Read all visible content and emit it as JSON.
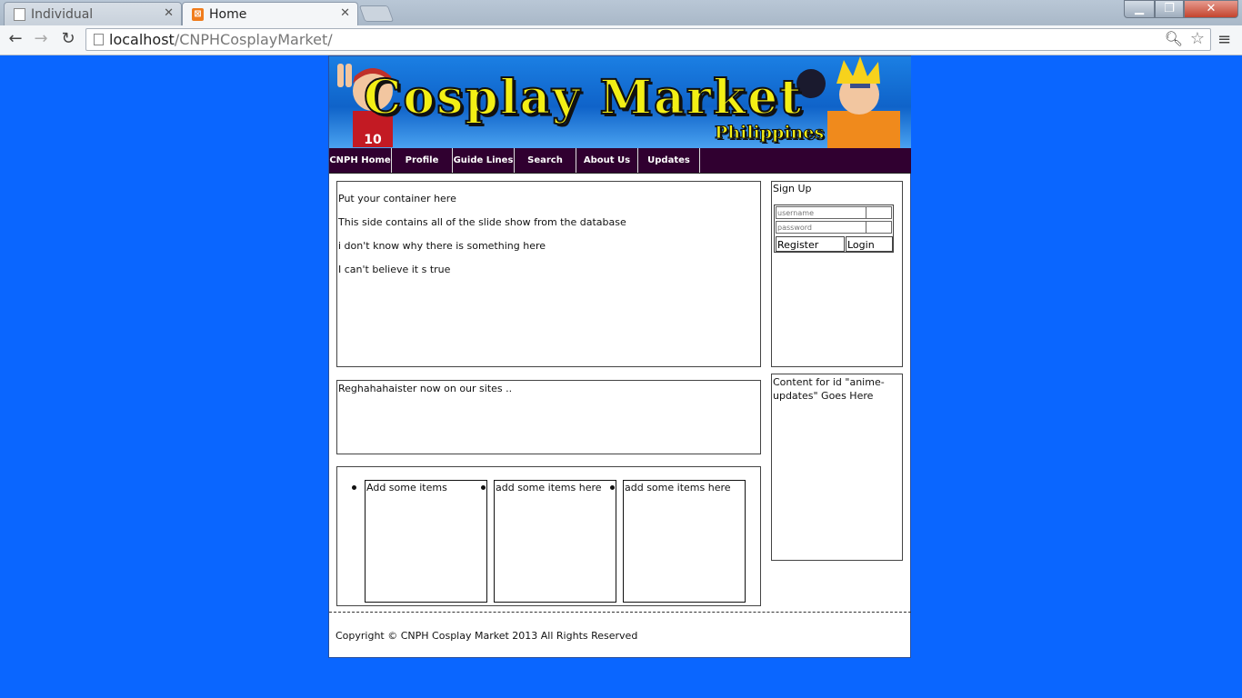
{
  "browser": {
    "tabs": [
      {
        "title": "Individual",
        "active": false
      },
      {
        "title": "Home",
        "active": true
      }
    ],
    "url_host": "localhost",
    "url_path": "/CNPHCosplayMarket/"
  },
  "banner": {
    "title": "Cosplay Market",
    "subtitle": "Philippines"
  },
  "nav": [
    "CNPH Home",
    "Profile",
    "Guide Lines",
    "Search",
    "About Us",
    "Updates"
  ],
  "slides": {
    "lines": [
      "Put your container here",
      "This side contains all of the slide show from the database",
      "i don't know why there is something here",
      "I can't believe it s true"
    ]
  },
  "register_text": "Reghahahaister now on our sites ..",
  "items": [
    "Add some items",
    "add some items here",
    "add some items here"
  ],
  "signup": {
    "title": "Sign Up",
    "username_placeholder": "username",
    "password_placeholder": "password",
    "register_label": "Register",
    "login_label": "Login"
  },
  "anime_updates": "Content for id \"anime-updates\" Goes Here",
  "footer": "Copyright © CNPH Cosplay Market 2013 All Rights Reserved",
  "colors": {
    "page_background": "#0a66ff",
    "nav_background": "#300030",
    "banner_title": "#f3ef15"
  }
}
